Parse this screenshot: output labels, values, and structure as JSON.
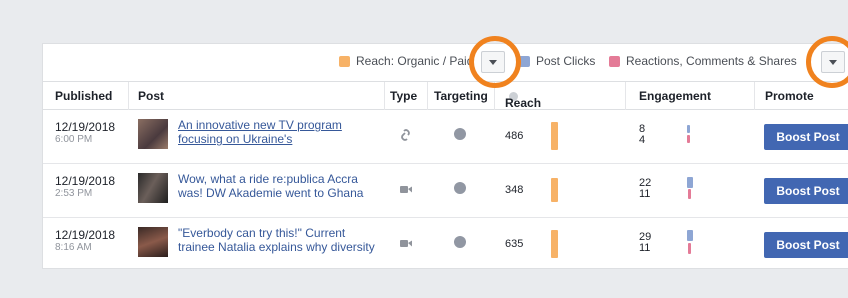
{
  "legend": {
    "reach_label": "Reach: Organic / Paid",
    "clicks_label": "Post Clicks",
    "reactions_label": "Reactions, Comments & Shares",
    "colors": {
      "reach": "#f7b267",
      "clicks": "#8ea6d4",
      "reactions": "#e47b97"
    }
  },
  "table": {
    "headers": {
      "published": "Published",
      "post": "Post",
      "type": "Type",
      "targeting": "Targeting",
      "reach": "Reach",
      "engagement": "Engagement",
      "promote": "Promote"
    },
    "rows": [
      {
        "date": "12/19/2018",
        "time": "6:00 PM",
        "post_line1": "An innovative new TV program",
        "post_line2": "focusing on Ukraine's",
        "type_icon": "link-icon",
        "reach": "486",
        "engagement_top": "8",
        "engagement_bottom": "4",
        "promote_label": "Boost Post"
      },
      {
        "date": "12/19/2018",
        "time": "2:53 PM",
        "post_line1": "Wow, what a ride re:publica Accra",
        "post_line2": "was! DW Akademie went to Ghana",
        "type_icon": "video-icon",
        "reach": "348",
        "engagement_top": "22",
        "engagement_bottom": "11",
        "promote_label": "Boost Post"
      },
      {
        "date": "12/19/2018",
        "time": "8:16 AM",
        "post_line1": "\"Everbody can try this!\" Current",
        "post_line2": "trainee Natalia explains why diversity",
        "type_icon": "video-icon",
        "reach": "635",
        "engagement_top": "29",
        "engagement_bottom": "11",
        "promote_label": "Boost Post"
      }
    ]
  }
}
